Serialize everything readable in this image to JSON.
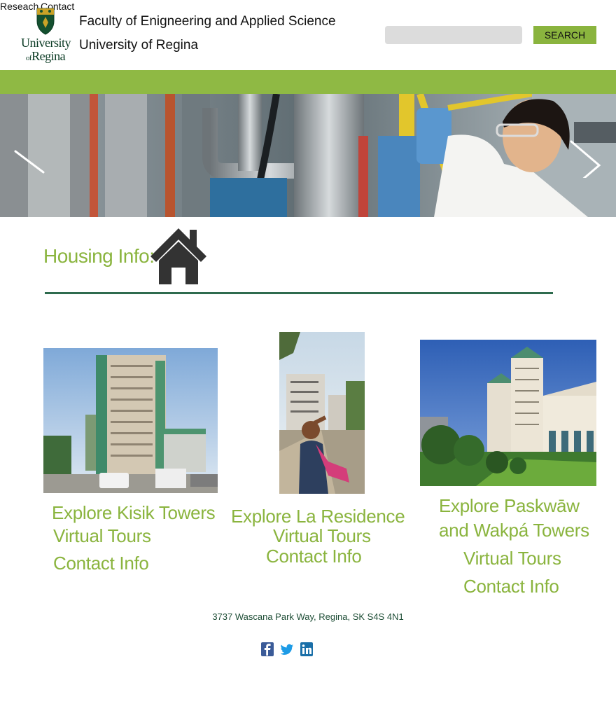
{
  "top_nav": {
    "research": "Reseach",
    "contact": "Contact"
  },
  "logo": {
    "line1": "University",
    "line2_small": "of",
    "line2": "Regina"
  },
  "header": {
    "faculty": "Faculty of Enigneering and Applied Science",
    "university": "University of Regina"
  },
  "search": {
    "placeholder": "",
    "button_label": "SEARCH"
  },
  "colors": {
    "accent_green": "#8ab43e",
    "band_green": "#8fb944",
    "divider": "#2e6b4e",
    "footer_text": "#1d4d35"
  },
  "hero": {
    "prev_icon": "chevron-left-icon",
    "next_icon": "chevron-right-icon"
  },
  "housing": {
    "label": "Housing Info:",
    "icon": "house-icon"
  },
  "residences": [
    {
      "title": "Explore Kisik Towers",
      "tours": "Virtual Tours",
      "contact": "Contact Info"
    },
    {
      "title": "Explore La Residence",
      "tours": "Virtual Tours",
      "contact": "Contact Info"
    },
    {
      "title_line1": "Explore Paskwāw",
      "title_line2": "and Wakpá Towers",
      "tours": "Virtual Tours",
      "contact": "Contact Info"
    }
  ],
  "footer": {
    "address": "3737 Wascana Park Way, Regina, SK S4S 4N1",
    "social_icons": [
      "facebook-icon",
      "twitter-icon",
      "linkedin-icon"
    ]
  }
}
